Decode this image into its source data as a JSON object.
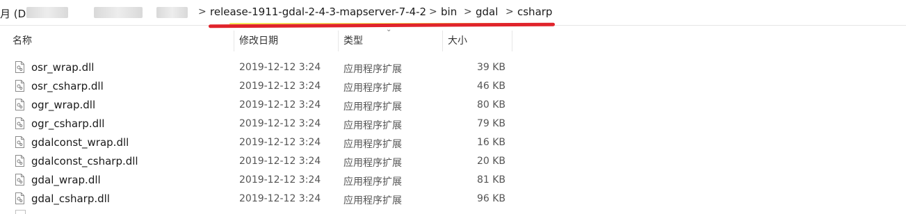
{
  "address_bar": {
    "prefix": "月 (D",
    "breadcrumbs": [
      "release-1911-gdal-2-4-3-mapserver-7-4-2",
      "bin",
      "gdal",
      "csharp"
    ],
    "separator": ">"
  },
  "columns": {
    "name": "名称",
    "date": "修改日期",
    "type": "类型",
    "size": "大小"
  },
  "files": [
    {
      "name": "osr_wrap.dll",
      "date": "2019-12-12 3:24",
      "type": "应用程序扩展",
      "size": "39 KB"
    },
    {
      "name": "osr_csharp.dll",
      "date": "2019-12-12 3:24",
      "type": "应用程序扩展",
      "size": "46 KB"
    },
    {
      "name": "ogr_wrap.dll",
      "date": "2019-12-12 3:24",
      "type": "应用程序扩展",
      "size": "80 KB"
    },
    {
      "name": "ogr_csharp.dll",
      "date": "2019-12-12 3:24",
      "type": "应用程序扩展",
      "size": "79 KB"
    },
    {
      "name": "gdalconst_wrap.dll",
      "date": "2019-12-12 3:24",
      "type": "应用程序扩展",
      "size": "16 KB"
    },
    {
      "name": "gdalconst_csharp.dll",
      "date": "2019-12-12 3:24",
      "type": "应用程序扩展",
      "size": "20 KB"
    },
    {
      "name": "gdal_wrap.dll",
      "date": "2019-12-12 3:24",
      "type": "应用程序扩展",
      "size": "81 KB"
    },
    {
      "name": "gdal_csharp.dll",
      "date": "2019-12-12 3:24",
      "type": "应用程序扩展",
      "size": "96 KB"
    }
  ],
  "icons": {
    "file": "dll-file-icon",
    "separator": "chevron-right-icon"
  },
  "colors": {
    "annotation_red": "#e0232b",
    "annotation_yellow": "#f2e84b"
  }
}
